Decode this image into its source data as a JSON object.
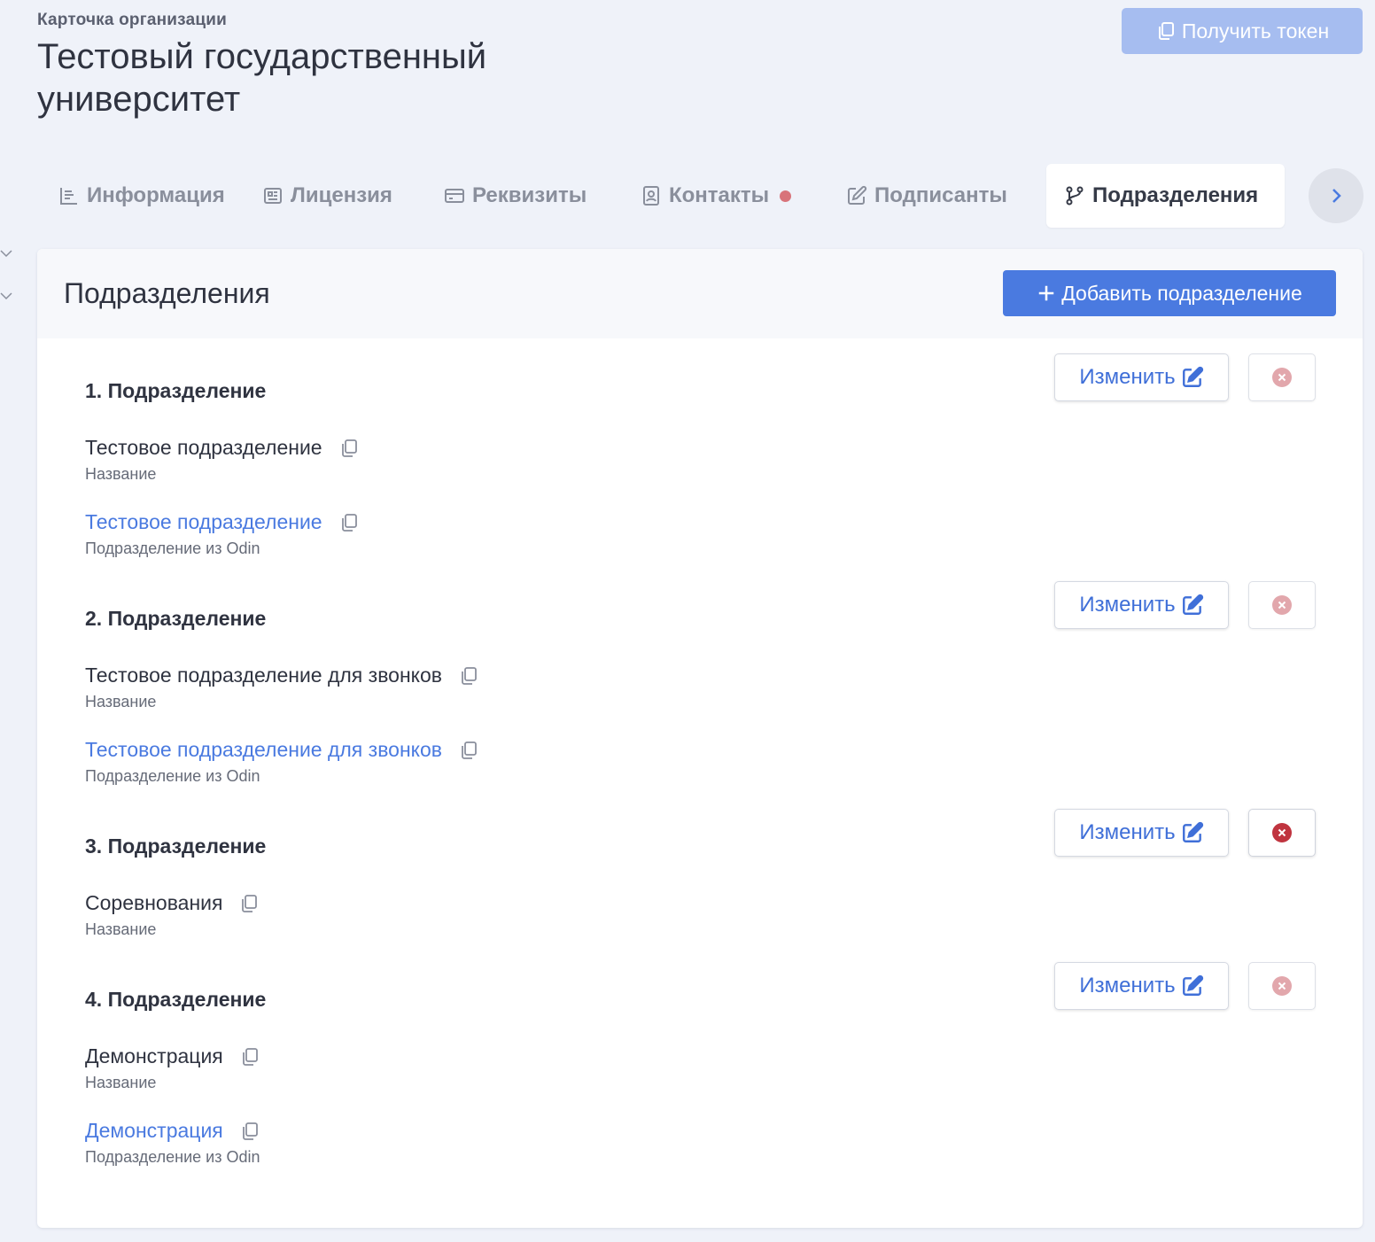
{
  "header": {
    "subtitle": "Карточка организации",
    "title": "Тестовый государственный университет",
    "token_button": "Получить токен"
  },
  "tabs": [
    {
      "label": "Информация",
      "icon": "chart-icon"
    },
    {
      "label": "Лицензия",
      "icon": "newspaper-icon"
    },
    {
      "label": "Реквизиты",
      "icon": "credit-card-icon"
    },
    {
      "label": "Контакты",
      "icon": "contact-icon",
      "has_dot": true
    },
    {
      "label": "Подписанты",
      "icon": "pen-square-icon"
    },
    {
      "label": "Подразделения",
      "icon": "branch-icon",
      "active": true
    }
  ],
  "card": {
    "title": "Подразделения",
    "add_button": "Добавить подразделение"
  },
  "edit_label": "Изменить",
  "sections": [
    {
      "title": "1. Подразделение",
      "name": "Тестовое подразделение",
      "name_label": "Название",
      "odin": "Тестовое подразделение",
      "odin_label": "Подразделение из Odin",
      "delete_enabled": false
    },
    {
      "title": "2. Подразделение",
      "name": "Тестовое подразделение для звонков",
      "name_label": "Название",
      "odin": "Тестовое подразделение для звонков",
      "odin_label": "Подразделение из Odin",
      "delete_enabled": false
    },
    {
      "title": "3. Подразделение",
      "name": "Соревнования",
      "name_label": "Название",
      "delete_enabled": true
    },
    {
      "title": "4. Подразделение",
      "name": "Демонстрация",
      "name_label": "Название",
      "odin": "Демонстрация",
      "odin_label": "Подразделение из Odin",
      "delete_enabled": false
    }
  ],
  "colors": {
    "accent": "#4a7ae0",
    "token_button": "#a6bdf0",
    "delete_active": "#c0343f",
    "delete_disabled": "#e2a7ac",
    "contact_dot": "#d8737a"
  }
}
